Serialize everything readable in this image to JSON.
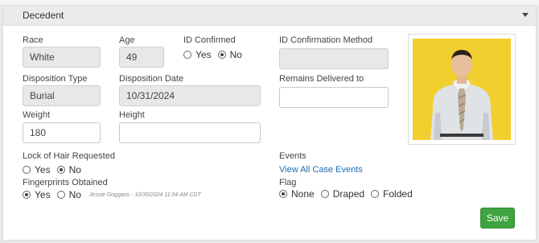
{
  "section": {
    "title": "Decedent"
  },
  "race": {
    "label": "Race",
    "value": "White"
  },
  "age": {
    "label": "Age",
    "value": "49"
  },
  "id_confirmed": {
    "label": "ID Confirmed",
    "options": [
      "Yes",
      "No"
    ],
    "selected": "No"
  },
  "id_confirmation_method": {
    "label": "ID Confirmation Method",
    "value": ""
  },
  "disposition_type": {
    "label": "Disposition Type",
    "value": "Burial"
  },
  "disposition_date": {
    "label": "Disposition Date",
    "value": "10/31/2024"
  },
  "remains_delivered_to": {
    "label": "Remains Delivered to",
    "value": ""
  },
  "weight": {
    "label": "Weight",
    "value": "180"
  },
  "height": {
    "label": "Height",
    "value": ""
  },
  "lock_of_hair": {
    "label": "Lock of Hair Requested",
    "options": [
      "Yes",
      "No"
    ],
    "selected": "No"
  },
  "fingerprints": {
    "label": "Fingerprints Obtained",
    "options": [
      "Yes",
      "No"
    ],
    "selected": "Yes",
    "meta": "Jessie Goggans - 10/30/2024 11:04 AM CDT"
  },
  "events": {
    "label": "Events",
    "link": "View All Case Events"
  },
  "flag": {
    "label": "Flag",
    "options": [
      "None",
      "Draped",
      "Folded"
    ],
    "selected": "None"
  },
  "actions": {
    "save_label": "Save"
  },
  "colors": {
    "accent_green": "#3fa33f",
    "link_blue": "#1f6bb0",
    "photo_bg": "#f1cf2e"
  }
}
